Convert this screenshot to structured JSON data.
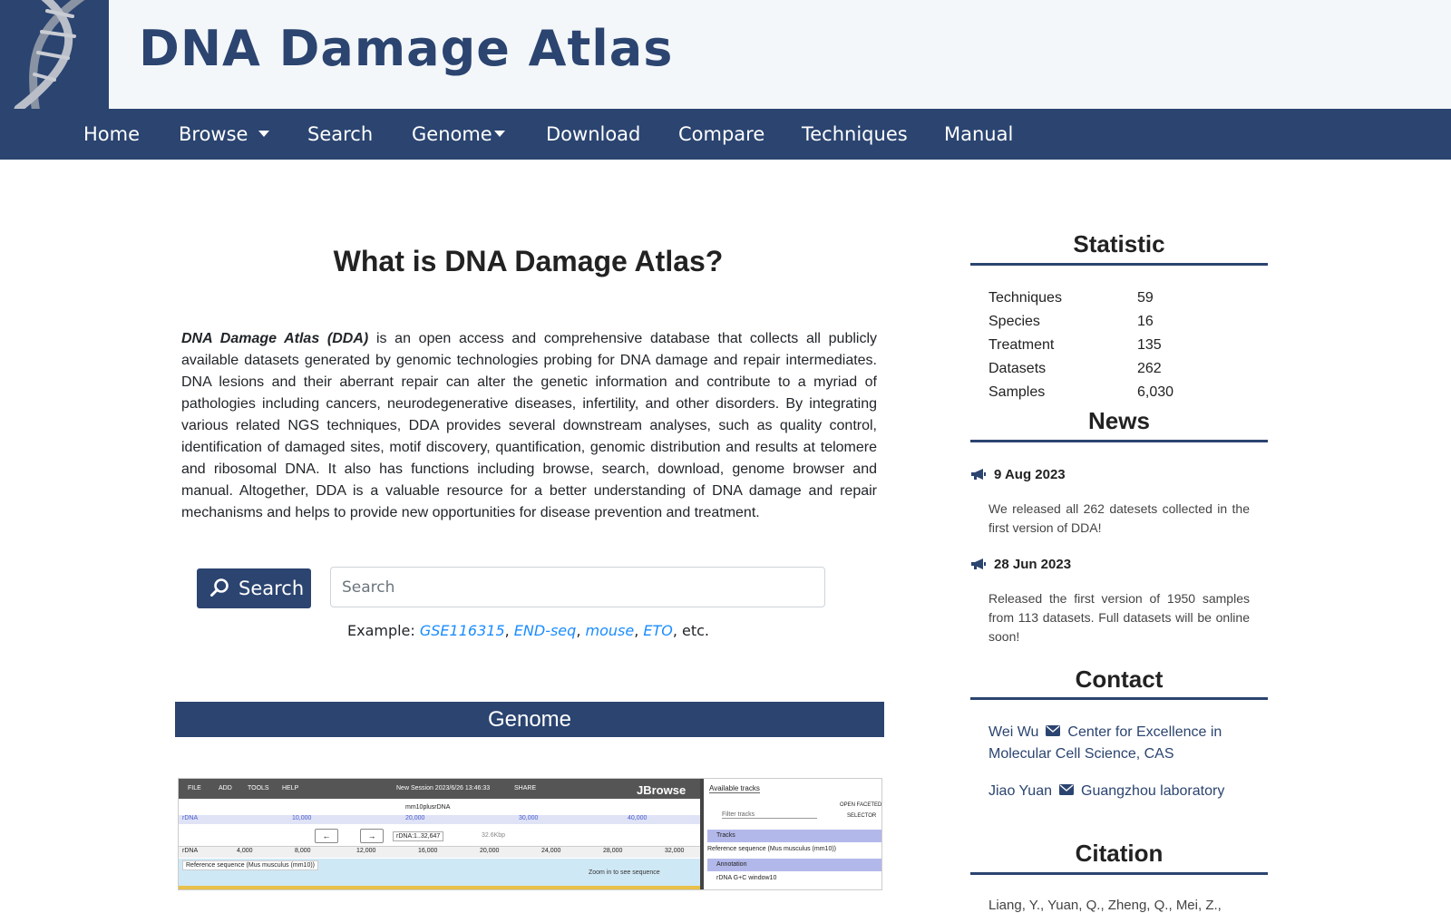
{
  "site": {
    "title": "DNA Damage Atlas"
  },
  "nav": {
    "home": "Home",
    "browse": "Browse",
    "search": "Search",
    "genome": "Genome",
    "download": "Download",
    "compare": "Compare",
    "techniques": "Techniques",
    "manual": "Manual"
  },
  "main": {
    "title": "What is DNA Damage Atlas?",
    "intro_bold": "DNA Damage Atlas (DDA)",
    "intro_text": " is an open access and comprehensive database that collects all publicly available datasets generated by genomic technologies probing for DNA damage and repair intermediates. DNA lesions and their aberrant repair can alter the genetic information and contribute to a myriad of pathologies including cancers, neurodegenerative diseases, infertility, and other disorders. By integrating various related NGS techniques, DDA provides several downstream analyses, such as quality control, identification of damaged sites, motif discovery, quantification, genomic distribution and results at telomere and ribosomal DNA. It also has functions including browse, search, download, genome browser and manual. Altogether, DDA is a valuable resource for a better understanding of DNA damage and repair mechanisms and helps to provide new opportunities for disease prevention and treatment.",
    "search_button": "Search",
    "search_placeholder": "Search",
    "example_label": "Example: ",
    "examples": [
      "GSE116315",
      "END-seq",
      "mouse",
      "ETO"
    ],
    "example_sep": ", ",
    "example_end": ", etc.",
    "genome_heading": "Genome"
  },
  "jbrowse": {
    "menu": [
      "FILE",
      "ADD",
      "TOOLS",
      "HELP"
    ],
    "session": "New Session 2023/6/26 13:46:33",
    "share": "SHARE",
    "brand": "JBrowse",
    "assembly": "mm10plusrDNA",
    "chrom": "rDNA",
    "locus": "rDNA:1..32,647",
    "span": "32.6Kbp",
    "ruler_top": [
      "10,000",
      "20,000",
      "30,000",
      "40,000"
    ],
    "ruler": [
      "4,000",
      "8,000",
      "12,000",
      "16,000",
      "20,000",
      "24,000",
      "28,000",
      "32,000"
    ],
    "track_name": "Reference sequence (Mus musculus (mm10))",
    "zoom_msg": "Zoom in to see sequence",
    "available_tracks": "Available tracks",
    "filter_placeholder": "Filter tracks",
    "open_faceted": "OPEN FACETED",
    "selector": "SELECTOR",
    "tracks_group": "Tracks",
    "annotation_group": "Annotation",
    "gc_track": "rDNA G+C window10"
  },
  "statistic": {
    "heading": "Statistic",
    "rows": [
      {
        "label": "Techniques",
        "value": "59"
      },
      {
        "label": "Species",
        "value": "16"
      },
      {
        "label": "Treatment",
        "value": "135"
      },
      {
        "label": "Datasets",
        "value": "262"
      },
      {
        "label": "Samples",
        "value": "6,030"
      }
    ]
  },
  "news": {
    "heading": "News",
    "items": [
      {
        "date": "9 Aug 2023",
        "text": "We released all 262 datesets collected in the first version of DDA!"
      },
      {
        "date": "28 Jun 2023",
        "text": "Released the first version of 1950 samples from 113 datasets. Full datasets will be online soon!"
      }
    ]
  },
  "contact": {
    "heading": "Contact",
    "people": [
      {
        "name": "Wei Wu",
        "org": "Center for Excellence in Molecular Cell Science, CAS"
      },
      {
        "name": "Jiao Yuan",
        "org": "Guangzhou laboratory"
      }
    ]
  },
  "citation": {
    "heading": "Citation",
    "text": "Liang, Y., Yuan, Q., Zheng, Q., Mei, Z.,"
  },
  "colors": {
    "brand": "#2b4470",
    "link": "#1a8cff",
    "header_bg": "#f4f7fa"
  }
}
